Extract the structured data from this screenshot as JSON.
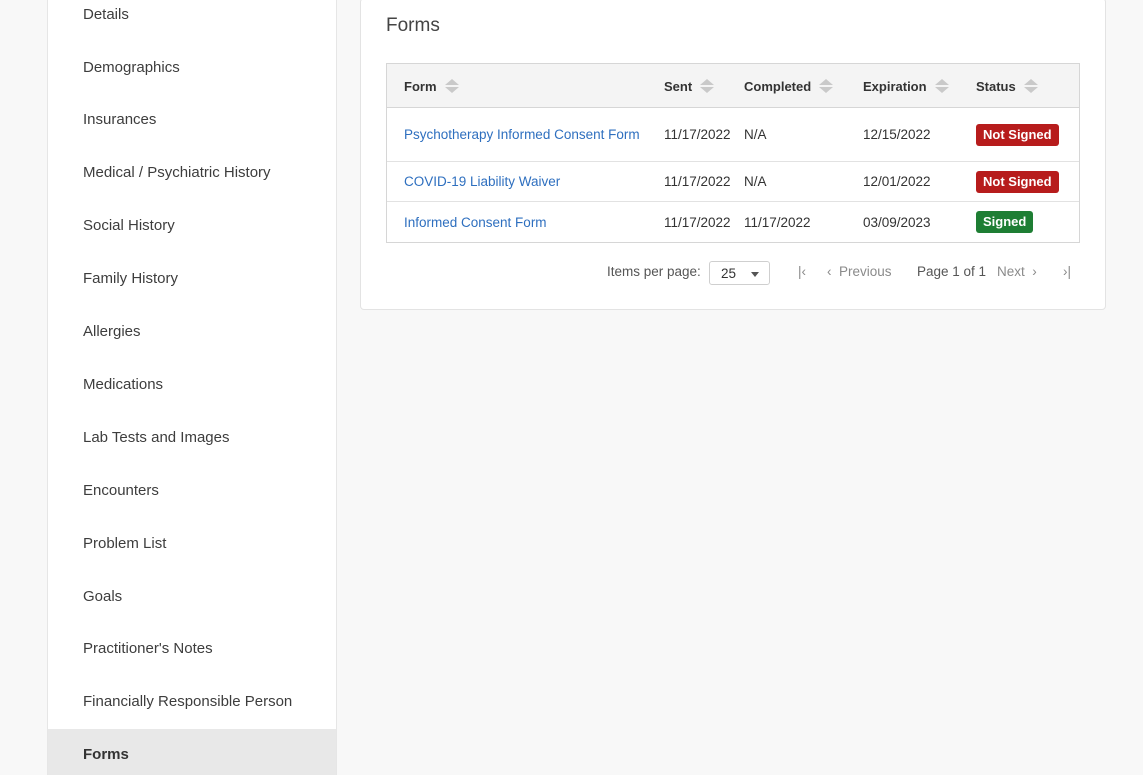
{
  "sidebar": {
    "items": [
      {
        "label": "Details"
      },
      {
        "label": "Demographics"
      },
      {
        "label": "Insurances"
      },
      {
        "label": "Medical / Psychiatric History"
      },
      {
        "label": "Social History"
      },
      {
        "label": "Family History"
      },
      {
        "label": "Allergies"
      },
      {
        "label": "Medications"
      },
      {
        "label": "Lab Tests and Images"
      },
      {
        "label": "Encounters"
      },
      {
        "label": "Problem List"
      },
      {
        "label": "Goals"
      },
      {
        "label": "Practitioner's Notes"
      },
      {
        "label": "Financially Responsible Person"
      },
      {
        "label": "Forms",
        "active": true
      }
    ]
  },
  "forms": {
    "title": "Forms",
    "columns": [
      "Form",
      "Sent",
      "Completed",
      "Expiration",
      "Status"
    ],
    "rows": [
      {
        "form": "Psychotherapy Informed Consent Form",
        "sent": "11/17/2022",
        "completed": "N/A",
        "expiration": "12/15/2022",
        "status": "Not Signed"
      },
      {
        "form": "COVID-19 Liability Waiver",
        "sent": "11/17/2022",
        "completed": "N/A",
        "expiration": "12/01/2022",
        "status": "Not Signed"
      },
      {
        "form": "Informed Consent Form",
        "sent": "11/17/2022",
        "completed": "11/17/2022",
        "expiration": "03/09/2023",
        "status": "Signed"
      }
    ],
    "status_colors": {
      "Not Signed": "#b71c1c",
      "Signed": "#1e7e34"
    },
    "pagination": {
      "items_per_page_label": "Items per page:",
      "items_per_page_value": "25",
      "first_icon": "first-page-icon",
      "previous_label": "Previous",
      "page_info": "Page 1 of 1",
      "next_label": "Next",
      "last_icon": "last-page-icon"
    }
  }
}
